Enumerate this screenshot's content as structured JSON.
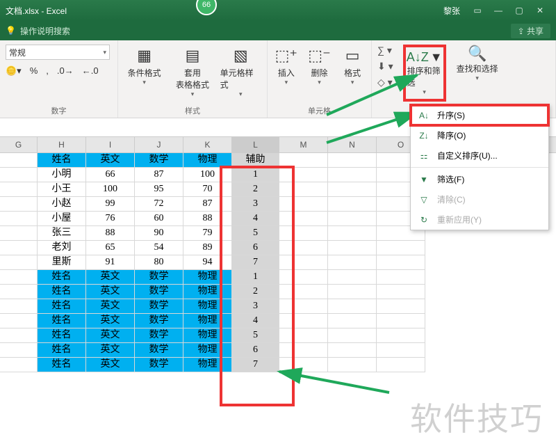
{
  "title": "文档.xlsx - Excel",
  "badge": "66",
  "user": "黎张",
  "searchbar": {
    "placeholder": "操作说明搜索",
    "share": "共享"
  },
  "ribbon": {
    "number_group": "数字",
    "number_format": "常规",
    "styles_group": "样式",
    "cond_format": "条件格式",
    "table_format": "套用\n表格格式",
    "cell_styles": "单元格样式",
    "cells_group": "单元格",
    "insert": "插入",
    "delete": "删除",
    "format": "格式",
    "sort_filter": "排序和筛选",
    "find_select": "查找和选择"
  },
  "sort_menu": {
    "asc": "升序(S)",
    "desc": "降序(O)",
    "custom": "自定义排序(U)...",
    "filter": "筛选(F)",
    "clear": "清除(C)",
    "reapply": "重新应用(Y)"
  },
  "columns": [
    "G",
    "H",
    "I",
    "J",
    "K",
    "L",
    "M",
    "N",
    "O"
  ],
  "headers": {
    "H": "姓名",
    "I": "英文",
    "J": "数学",
    "K": "物理",
    "L": "辅助"
  },
  "data_rows": [
    {
      "H": "小明",
      "I": 66,
      "J": 87,
      "K": 100,
      "L": 1
    },
    {
      "H": "小王",
      "I": 100,
      "J": 95,
      "K": 70,
      "L": 2
    },
    {
      "H": "小赵",
      "I": 99,
      "J": 72,
      "K": 87,
      "L": 3
    },
    {
      "H": "小屋",
      "I": 76,
      "J": 60,
      "K": 88,
      "L": 4
    },
    {
      "H": "张三",
      "I": 88,
      "J": 90,
      "K": 79,
      "L": 5
    },
    {
      "H": "老刘",
      "I": 65,
      "J": 54,
      "K": 89,
      "L": 6
    },
    {
      "H": "里斯",
      "I": 91,
      "J": 80,
      "K": 94,
      "L": 7
    }
  ],
  "repeat_rows": [
    {
      "H": "姓名",
      "I": "英文",
      "J": "数学",
      "K": "物理",
      "L": 1
    },
    {
      "H": "姓名",
      "I": "英文",
      "J": "数学",
      "K": "物理",
      "L": 2
    },
    {
      "H": "姓名",
      "I": "英文",
      "J": "数学",
      "K": "物理",
      "L": 3
    },
    {
      "H": "姓名",
      "I": "英文",
      "J": "数学",
      "K": "物理",
      "L": 4
    },
    {
      "H": "姓名",
      "I": "英文",
      "J": "数学",
      "K": "物理",
      "L": 5
    },
    {
      "H": "姓名",
      "I": "英文",
      "J": "数学",
      "K": "物理",
      "L": 6
    },
    {
      "H": "姓名",
      "I": "英文",
      "J": "数学",
      "K": "物理",
      "L": 7
    }
  ],
  "watermark": "软件技巧"
}
